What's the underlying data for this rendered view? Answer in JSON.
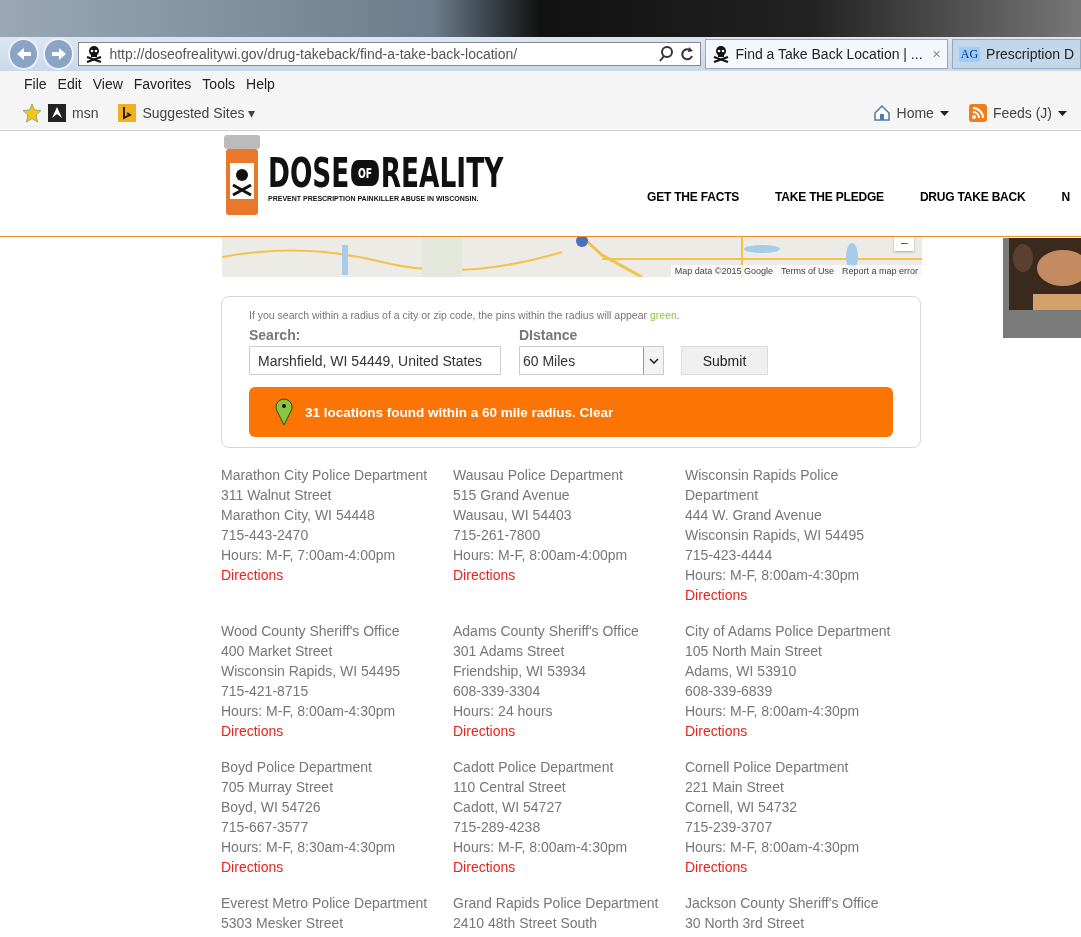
{
  "browser": {
    "url": "http://doseofrealitywi.gov/drug-takeback/find-a-take-back-location/",
    "tabs": [
      {
        "label": "Find a Take Back Location | ...",
        "selected": true,
        "close": "×"
      },
      {
        "label": "Prescription D",
        "selected": false,
        "icon_text": "AG"
      }
    ],
    "menu": [
      "File",
      "Edit",
      "View",
      "Favorites",
      "Tools",
      "Help"
    ],
    "favorites": [
      {
        "kind": "msn",
        "label": "msn"
      },
      {
        "kind": "bing",
        "label": "Suggested Sites ▾"
      }
    ],
    "commands": [
      {
        "kind": "home",
        "label": "Home"
      },
      {
        "kind": "feeds",
        "label": "Feeds (J)"
      }
    ]
  },
  "site": {
    "logo": {
      "word_1": "DOSE",
      "word_2": "OF",
      "word_3": "REALITY",
      "tagline": "PREVENT PRESCRIPTION PAINKILLER ABUSE IN WISCONSIN."
    },
    "nav": [
      "GET THE FACTS",
      "TAKE THE PLEDGE",
      "DRUG TAKE BACK",
      "N"
    ],
    "map": {
      "kind": "picture",
      "attribution": [
        "Map data ©2015 Google",
        "Terms of Use",
        "Report a map error"
      ],
      "zoom_out": "−"
    }
  },
  "search": {
    "note": "If you search within a radius of a city or zip code, the pins within the radius will appear *green*.",
    "search_label": "Search:",
    "search_value": "Marshfield, WI 54449, United States",
    "distance_label": "DIstance",
    "distance_value": "60 Miles",
    "submit": "Submit",
    "result": "31 locations found within a 60 mile radius. Clear"
  },
  "locations": [
    {
      "name": "Marathon City Police Department",
      "lines": [
        "311 Walnut Street",
        "Marathon City, WI 54448",
        "715-443-2470",
        "Hours: M-F, 7:00am-4:00pm"
      ],
      "link": "Directions"
    },
    {
      "name": "Wausau Police Department",
      "lines": [
        "515 Grand Avenue",
        "Wausau, WI 54403",
        "715-261-7800",
        "Hours: M-F, 8:00am-4:00pm"
      ],
      "link": "Directions"
    },
    {
      "name": "Wisconsin Rapids Police Department",
      "lines": [
        "444 W. Grand Avenue",
        "Wisconsin Rapids, WI 54495",
        "715-423-4444",
        "Hours: M-F, 8:00am-4:30pm"
      ],
      "link": "Directions"
    },
    {
      "name": "Wood County Sheriff's Office",
      "lines": [
        "400 Market Street",
        "Wisconsin Rapids, WI 54495",
        "715-421-8715",
        "Hours: M-F, 8:00am-4:30pm"
      ],
      "link": "Directions"
    },
    {
      "name": "Adams County Sheriff's Office",
      "lines": [
        "301 Adams Street",
        "Friendship, WI 53934",
        "608-339-3304",
        "Hours: 24 hours"
      ],
      "link": "Directions"
    },
    {
      "name": "City of Adams Police Department",
      "lines": [
        "105 North Main Street",
        "Adams, WI 53910",
        "608-339-6839",
        "Hours: M-F, 8:00am-4:30pm"
      ],
      "link": "Directions"
    },
    {
      "name": "Boyd Police Department",
      "lines": [
        "705 Murray Street",
        "Boyd, WI 54726",
        "715-667-3577",
        "Hours: M-F, 8:30am-4:30pm"
      ],
      "link": "Directions"
    },
    {
      "name": "Cadott Police Department",
      "lines": [
        "110 Central Street",
        "Cadott, WI 54727",
        "715-289-4238",
        "Hours: M-F, 8:00am-4:30pm"
      ],
      "link": "Directions"
    },
    {
      "name": "Cornell Police Department",
      "lines": [
        "221 Main Street",
        "Cornell, WI 54732",
        "715-239-3707",
        "Hours: M-F, 8:00am-4:30pm"
      ],
      "link": "Directions"
    },
    {
      "name": "Everest Metro Police Department",
      "lines": [
        "5303 Mesker Street"
      ]
    },
    {
      "name": "Grand Rapids Police Department",
      "lines": [
        "2410 48th Street South"
      ]
    },
    {
      "name": "Jackson County Sheriff's Office",
      "lines": [
        "30 North 3rd Street"
      ]
    }
  ]
}
